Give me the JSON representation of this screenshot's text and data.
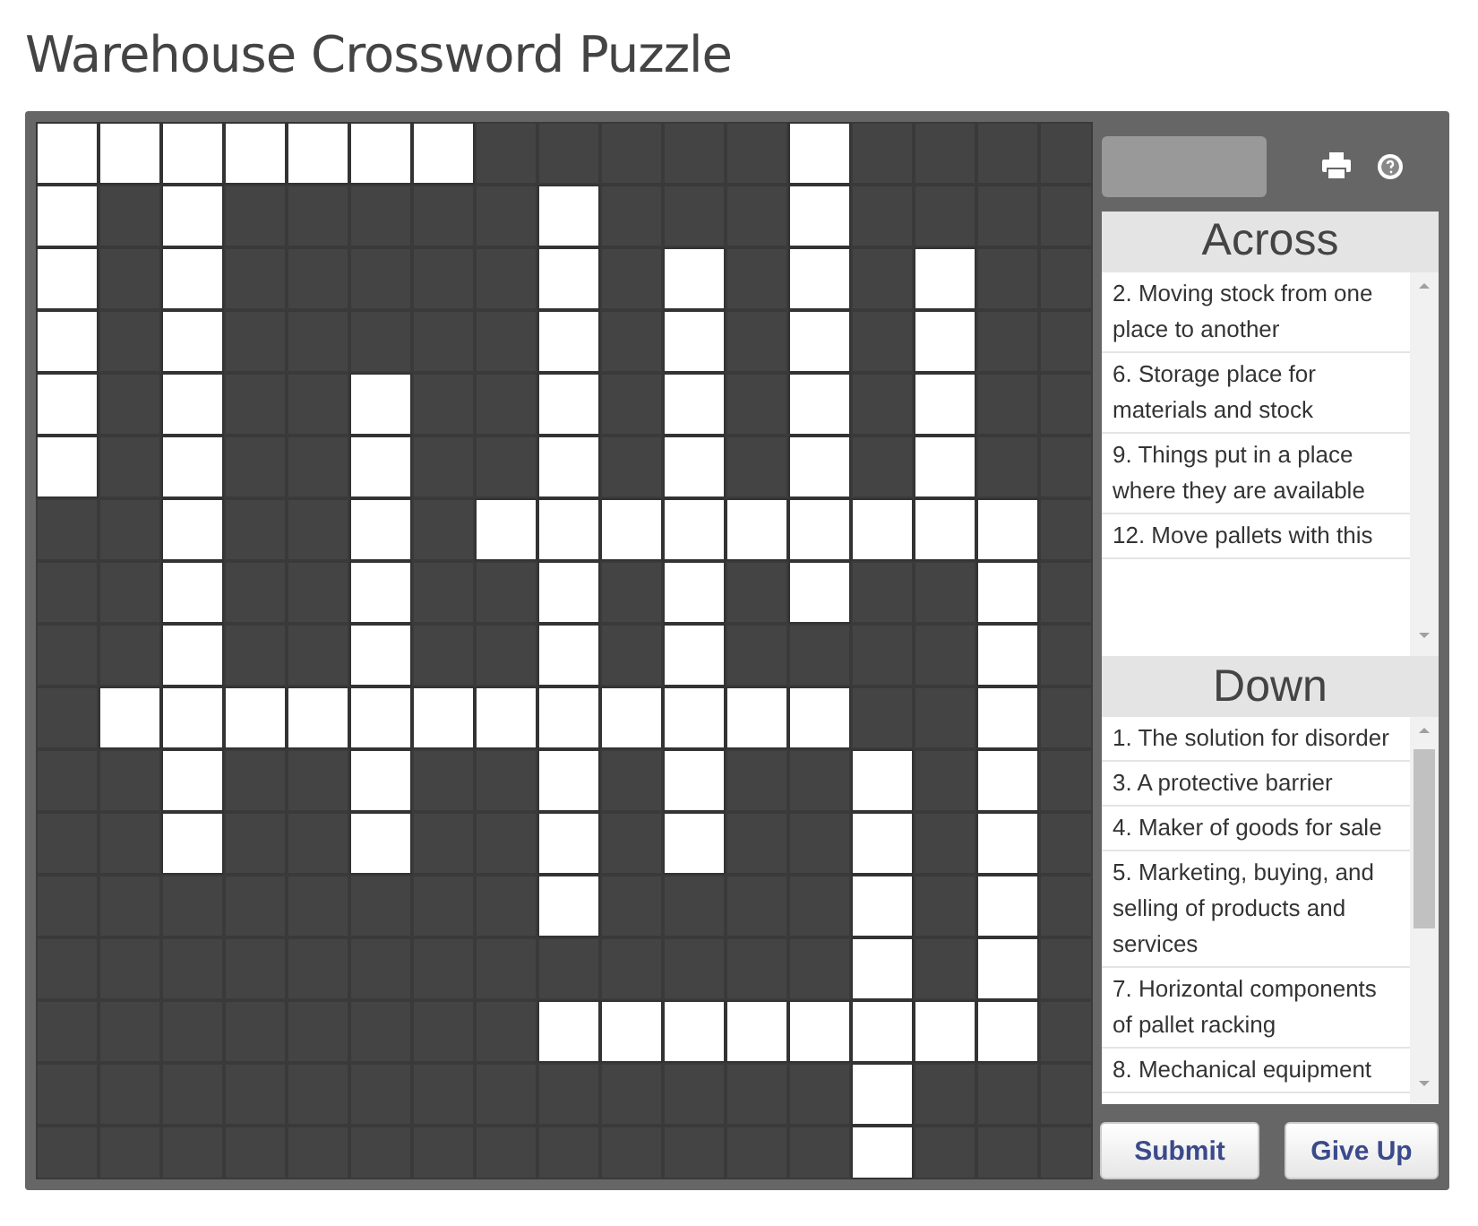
{
  "title": "Warehouse Crossword Puzzle",
  "grid": {
    "rows": [
      [
        true,
        true,
        true,
        true,
        true,
        true,
        true,
        false,
        false,
        false,
        false,
        false,
        true,
        false,
        false,
        false,
        false
      ],
      [
        true,
        false,
        true,
        false,
        false,
        false,
        false,
        false,
        true,
        false,
        false,
        false,
        true,
        false,
        false,
        false,
        false
      ],
      [
        true,
        false,
        true,
        false,
        false,
        false,
        false,
        false,
        true,
        false,
        true,
        false,
        true,
        false,
        true,
        false,
        false
      ],
      [
        true,
        false,
        true,
        false,
        false,
        false,
        false,
        false,
        true,
        false,
        true,
        false,
        true,
        false,
        true,
        false,
        false
      ],
      [
        true,
        false,
        true,
        false,
        false,
        true,
        false,
        false,
        true,
        false,
        true,
        false,
        true,
        false,
        true,
        false,
        false
      ],
      [
        true,
        false,
        true,
        false,
        false,
        true,
        false,
        false,
        true,
        false,
        true,
        false,
        true,
        false,
        true,
        false,
        false
      ],
      [
        false,
        false,
        true,
        false,
        false,
        true,
        false,
        true,
        true,
        true,
        true,
        true,
        true,
        true,
        true,
        true,
        false
      ],
      [
        false,
        false,
        true,
        false,
        false,
        true,
        false,
        false,
        true,
        false,
        true,
        false,
        true,
        false,
        false,
        true,
        false
      ],
      [
        false,
        false,
        true,
        false,
        false,
        true,
        false,
        false,
        true,
        false,
        true,
        false,
        false,
        false,
        false,
        true,
        false
      ],
      [
        false,
        true,
        true,
        true,
        true,
        true,
        true,
        true,
        true,
        true,
        true,
        true,
        true,
        false,
        false,
        true,
        false
      ],
      [
        false,
        false,
        true,
        false,
        false,
        true,
        false,
        false,
        true,
        false,
        true,
        false,
        false,
        true,
        false,
        true,
        false
      ],
      [
        false,
        false,
        true,
        false,
        false,
        true,
        false,
        false,
        true,
        false,
        true,
        false,
        false,
        true,
        false,
        true,
        false
      ],
      [
        false,
        false,
        false,
        false,
        false,
        false,
        false,
        false,
        true,
        false,
        false,
        false,
        false,
        true,
        false,
        true,
        false
      ],
      [
        false,
        false,
        false,
        false,
        false,
        false,
        false,
        false,
        false,
        false,
        false,
        false,
        false,
        true,
        false,
        true,
        false
      ],
      [
        false,
        false,
        false,
        false,
        false,
        false,
        false,
        false,
        true,
        true,
        true,
        true,
        true,
        true,
        true,
        true,
        false
      ],
      [
        false,
        false,
        false,
        false,
        false,
        false,
        false,
        false,
        false,
        false,
        false,
        false,
        false,
        true,
        false,
        false,
        false
      ],
      [
        false,
        false,
        false,
        false,
        false,
        false,
        false,
        false,
        false,
        false,
        false,
        false,
        false,
        true,
        false,
        false,
        false
      ]
    ]
  },
  "across": {
    "heading": "Across",
    "clues": [
      "2. Moving stock from one place to another",
      "6. Storage place for materials and stock",
      "9. Things put in a place where they are available",
      "12. Move pallets with this"
    ]
  },
  "down": {
    "heading": "Down",
    "clues": [
      "1. The solution for disorder",
      "3. A protective barrier",
      "4. Maker of goods for sale",
      "5. Marketing, buying, and selling of products and services",
      "7. Horizontal components of pallet racking",
      "8. Mechanical equipment"
    ]
  },
  "buttons": [
    "Submit",
    "Give Up"
  ]
}
